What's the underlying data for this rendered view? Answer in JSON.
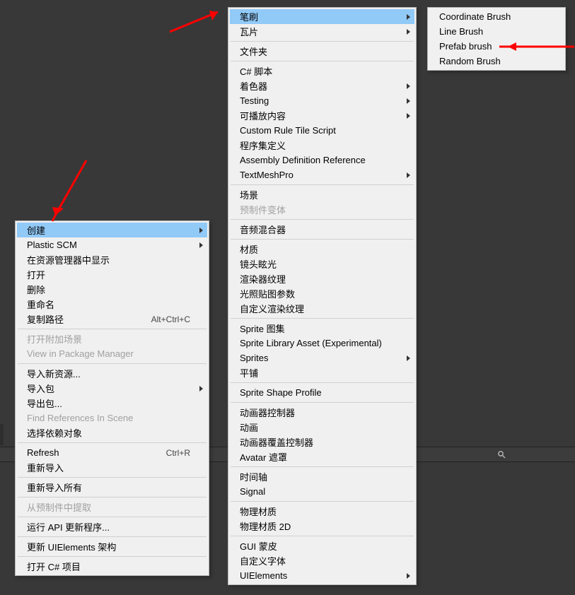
{
  "context_menu_1": {
    "items": [
      {
        "label": "创建",
        "sub": true,
        "highlight": true
      },
      {
        "label": "Plastic SCM",
        "sub": true
      },
      {
        "label": "在资源管理器中显示"
      },
      {
        "label": "打开"
      },
      {
        "label": "删除"
      },
      {
        "label": "重命名"
      },
      {
        "label": "复制路径",
        "accel": "Alt+Ctrl+C"
      },
      {
        "sep": true
      },
      {
        "label": "打开附加场景",
        "disabled": true
      },
      {
        "label": "View in Package Manager",
        "disabled": true
      },
      {
        "sep": true
      },
      {
        "label": "导入新资源..."
      },
      {
        "label": "导入包",
        "sub": true
      },
      {
        "label": "导出包..."
      },
      {
        "label": "Find References In Scene",
        "disabled": true
      },
      {
        "label": "选择依赖对象"
      },
      {
        "sep": true
      },
      {
        "label": "Refresh",
        "accel": "Ctrl+R"
      },
      {
        "label": "重新导入"
      },
      {
        "sep": true
      },
      {
        "label": "重新导入所有"
      },
      {
        "sep": true
      },
      {
        "label": "从预制件中提取",
        "disabled": true
      },
      {
        "sep": true
      },
      {
        "label": "运行 API 更新程序..."
      },
      {
        "sep": true
      },
      {
        "label": "更新 UIElements 架构"
      },
      {
        "sep": true
      },
      {
        "label": "打开 C# 项目"
      }
    ]
  },
  "context_menu_2": {
    "items": [
      {
        "label": "笔刷",
        "sub": true,
        "highlight": true
      },
      {
        "label": "瓦片",
        "sub": true
      },
      {
        "sep": true
      },
      {
        "label": "文件夹"
      },
      {
        "sep": true
      },
      {
        "label": "C# 脚本"
      },
      {
        "label": "着色器",
        "sub": true
      },
      {
        "label": "Testing",
        "sub": true
      },
      {
        "label": "可播放内容",
        "sub": true
      },
      {
        "label": "Custom Rule Tile Script"
      },
      {
        "label": "程序集定义"
      },
      {
        "label": "Assembly Definition Reference"
      },
      {
        "label": "TextMeshPro",
        "sub": true
      },
      {
        "sep": true
      },
      {
        "label": "场景"
      },
      {
        "label": "预制件变体",
        "disabled": true
      },
      {
        "sep": true
      },
      {
        "label": "音频混合器"
      },
      {
        "sep": true
      },
      {
        "label": "材质"
      },
      {
        "label": "镜头眩光"
      },
      {
        "label": "渲染器纹理"
      },
      {
        "label": "光照贴图参数"
      },
      {
        "label": "自定义渲染纹理"
      },
      {
        "sep": true
      },
      {
        "label": "Sprite 图集"
      },
      {
        "label": "Sprite Library Asset  (Experimental)"
      },
      {
        "label": "Sprites",
        "sub": true
      },
      {
        "label": "平铺"
      },
      {
        "sep": true
      },
      {
        "label": "Sprite Shape Profile"
      },
      {
        "sep": true
      },
      {
        "label": "动画器控制器"
      },
      {
        "label": "动画"
      },
      {
        "label": "动画器覆盖控制器"
      },
      {
        "label": "Avatar 遮罩"
      },
      {
        "sep": true
      },
      {
        "label": "时间轴"
      },
      {
        "label": "Signal"
      },
      {
        "sep": true
      },
      {
        "label": "物理材质"
      },
      {
        "label": "物理材质 2D"
      },
      {
        "sep": true
      },
      {
        "label": "GUI 蒙皮"
      },
      {
        "label": "自定义字体"
      },
      {
        "label": "UIElements",
        "sub": true
      }
    ]
  },
  "context_menu_3": {
    "items": [
      {
        "label": "Coordinate Brush"
      },
      {
        "label": "Line Brush"
      },
      {
        "label": "Prefab brush"
      },
      {
        "label": "Random Brush"
      }
    ]
  }
}
